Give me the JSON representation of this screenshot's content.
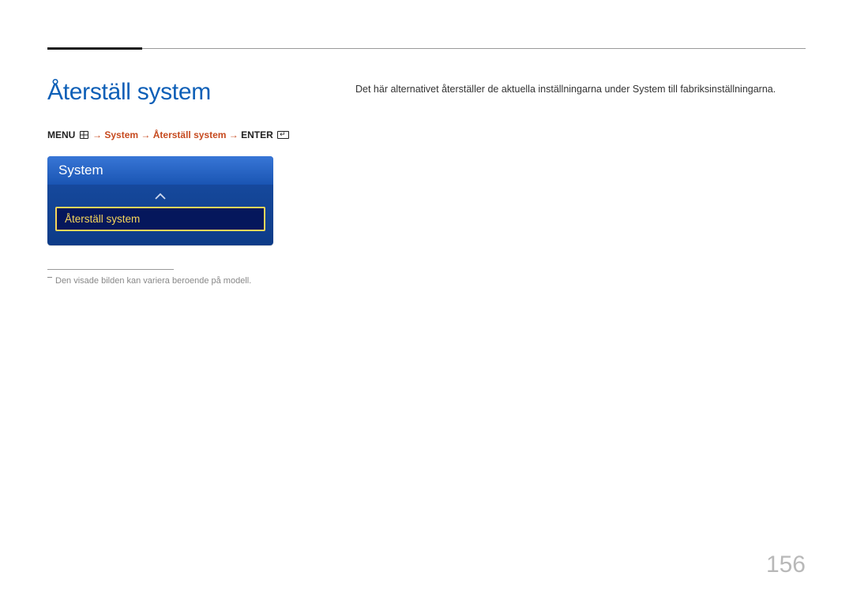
{
  "title": "Återställ system",
  "breadcrumb": {
    "part1": "MENU",
    "arrow": "→",
    "path": "System → Återställ system",
    "part3": "ENTER"
  },
  "menu": {
    "header": "System",
    "item": "Återställ system"
  },
  "footnote": "Den visade bilden kan variera beroende på modell.",
  "description": "Det här alternativet återställer de aktuella inställningarna under System till fabriksinställningarna.",
  "pageNumber": "156"
}
